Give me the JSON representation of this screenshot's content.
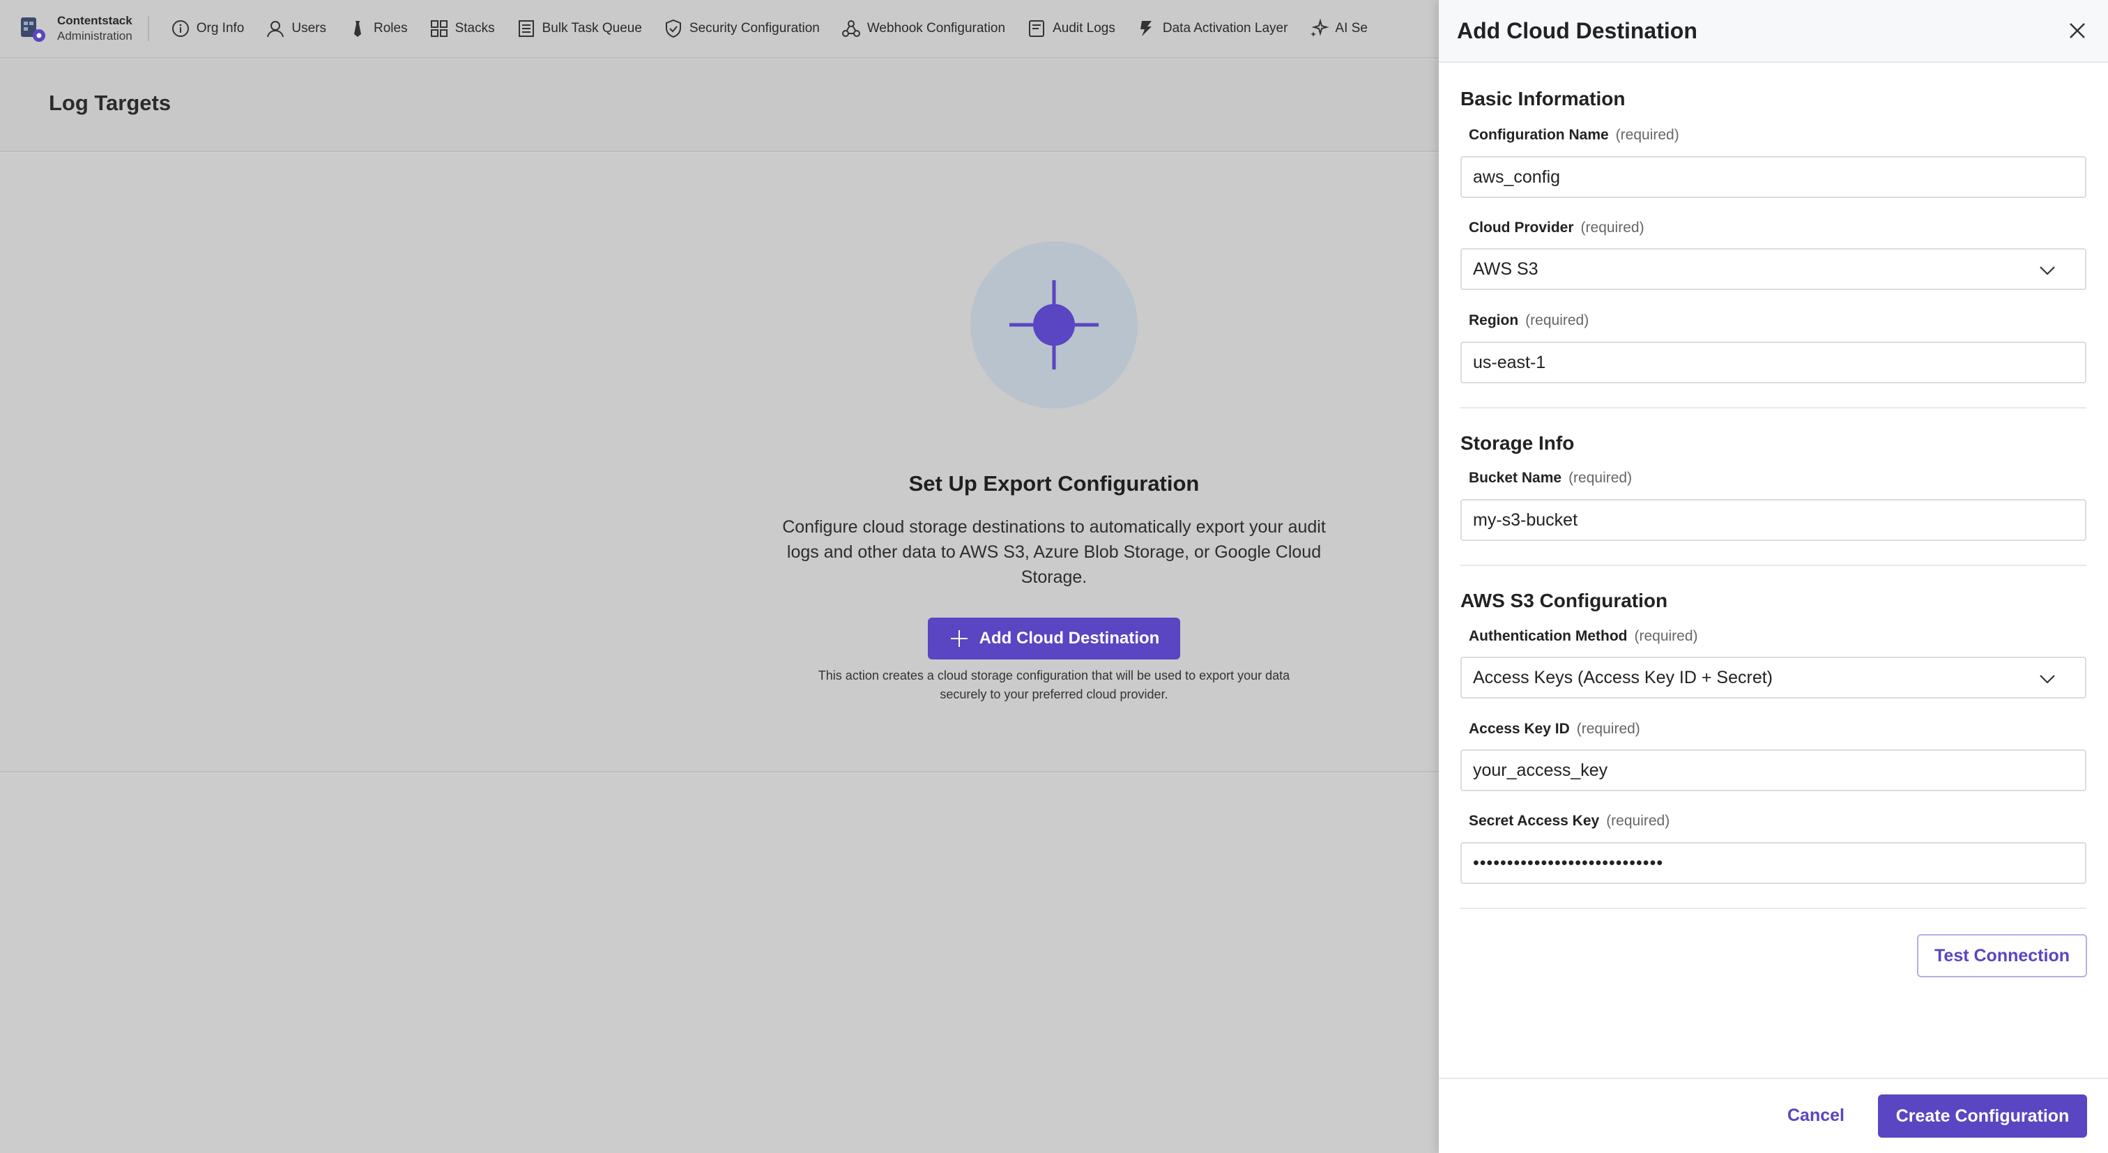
{
  "brand": {
    "name": "Contentstack",
    "sub": "Administration"
  },
  "nav": [
    {
      "label": "Org Info",
      "icon": "info-icon"
    },
    {
      "label": "Users",
      "icon": "user-icon"
    },
    {
      "label": "Roles",
      "icon": "tie-icon"
    },
    {
      "label": "Stacks",
      "icon": "grid-icon"
    },
    {
      "label": "Bulk Task Queue",
      "icon": "list-icon"
    },
    {
      "label": "Security Configuration",
      "icon": "shield-icon"
    },
    {
      "label": "Webhook Configuration",
      "icon": "webhook-icon"
    },
    {
      "label": "Audit Logs",
      "icon": "log-icon"
    },
    {
      "label": "Data Activation Layer",
      "icon": "layers-icon"
    },
    {
      "label": "AI Se",
      "icon": "sparkle-icon"
    }
  ],
  "page": {
    "title": "Log Targets"
  },
  "empty_state": {
    "title": "Set Up Export Configuration",
    "description": "Configure cloud storage destinations to automatically export your audit logs and other data to AWS S3, Azure Blob Storage, or Google Cloud Storage.",
    "button": "Add Cloud Destination",
    "note": "This action creates a cloud storage configuration that will be used to export your data securely to your preferred cloud provider."
  },
  "panel": {
    "title": "Add Cloud Destination",
    "basic_title": "Basic Information",
    "config_name_label": "Configuration Name",
    "config_name_value": "aws_config",
    "cloud_provider_label": "Cloud Provider",
    "cloud_provider_value": "AWS S3",
    "region_label": "Region",
    "region_value": "us-east-1",
    "storage_title": "Storage Info",
    "bucket_label": "Bucket Name",
    "bucket_value": "my-s3-bucket",
    "aws_title": "AWS S3 Configuration",
    "auth_label": "Authentication Method",
    "auth_value": "Access Keys (Access Key ID + Secret)",
    "access_key_label": "Access Key ID",
    "access_key_value": "your_access_key",
    "secret_label": "Secret Access Key",
    "secret_value": "••••••••••••••••••••••••••••",
    "required": "(required)",
    "test_button": "Test Connection",
    "cancel_button": "Cancel",
    "create_button": "Create Configuration"
  },
  "colors": {
    "accent": "#5a45c2",
    "overlay": "#cbcbcb",
    "circle": "#b9c3cd"
  }
}
